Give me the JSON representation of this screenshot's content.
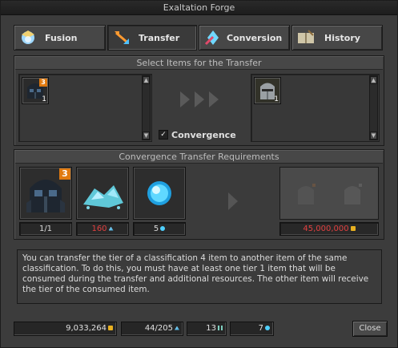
{
  "window": {
    "title": "Exaltation Forge"
  },
  "tabs": [
    {
      "label": "Fusion",
      "icon": "fusion-icon",
      "active": false
    },
    {
      "label": "Transfer",
      "icon": "transfer-icon",
      "active": true
    },
    {
      "label": "Conversion",
      "icon": "conversion-icon",
      "active": false
    },
    {
      "label": "History",
      "icon": "history-icon",
      "active": false
    }
  ],
  "select_panel": {
    "title": "Select Items for the Transfer",
    "source_item": {
      "name": "dark helmet",
      "tier": "3",
      "count": "1"
    },
    "target_item": {
      "name": "steel knight helmet",
      "count": "1"
    },
    "convergence": {
      "label": "Convergence",
      "checked": true
    }
  },
  "requirements": {
    "title": "Convergence Transfer Requirements",
    "item": {
      "name": "dark helmet",
      "tier": "3",
      "count": "1/1"
    },
    "dust": {
      "name": "dust",
      "count": "160"
    },
    "cores": {
      "name": "exaltation core",
      "count": "5"
    },
    "cost": {
      "value": "45,000,000"
    },
    "colors": {
      "insufficient": "#e04040",
      "ok": "#d8d8d8"
    }
  },
  "description": "You can transfer the tier of a classification 4 item to another item of the same classification. To do this, you must have at least one tier 1 item that will be consumed during the transfer and additional resources. The other item will receive the tier of the consumed item.",
  "resources": {
    "gold": "9,033,264",
    "dust": "44/205",
    "slivers": "13",
    "cores": "7"
  },
  "close_label": "Close"
}
